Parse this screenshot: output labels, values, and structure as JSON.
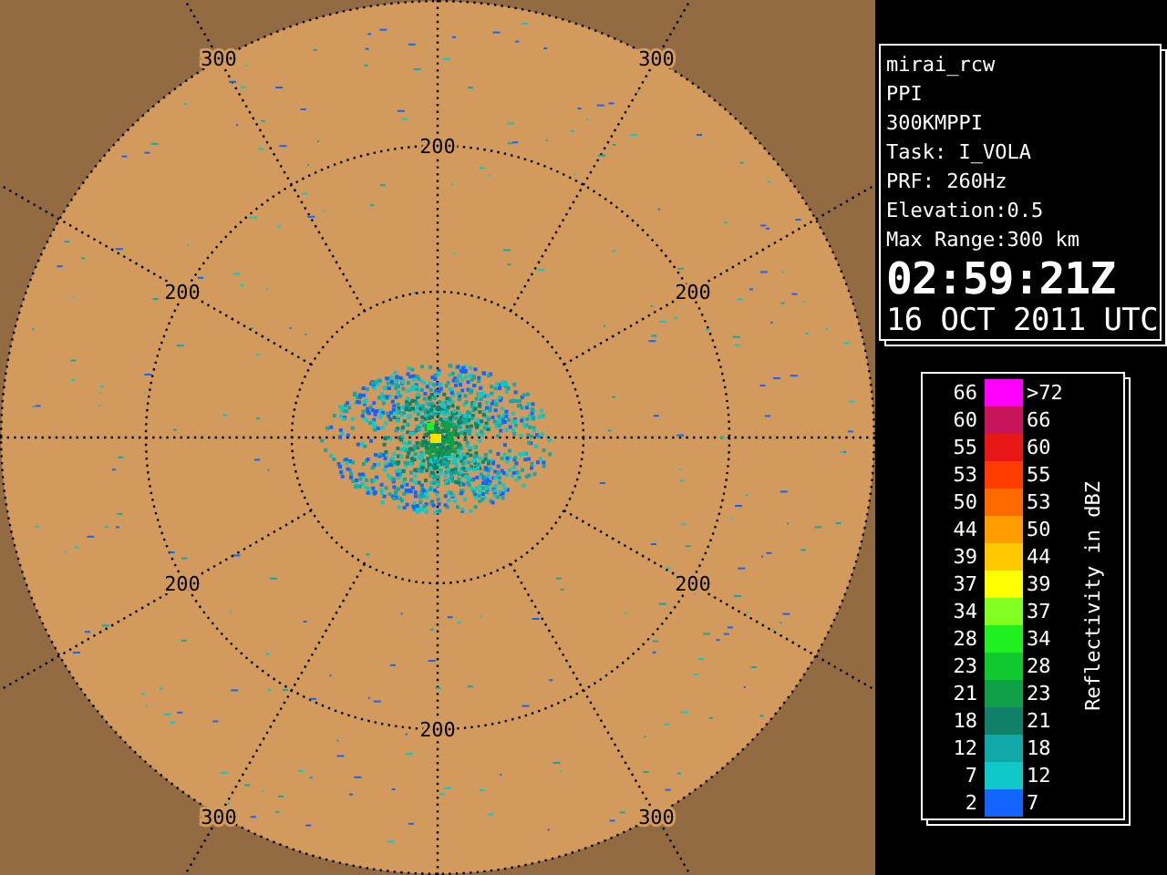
{
  "radar": {
    "range_labels": [
      "300",
      "300",
      "200",
      "200",
      "200",
      "200",
      "200",
      "200",
      "300",
      "300"
    ]
  },
  "info": {
    "lines": [
      "mirai_rcw",
      "PPI",
      "300KMPPI",
      "Task: I_VOLA",
      "PRF: 260Hz",
      "Elevation:0.5",
      "Max Range:300 km"
    ],
    "time": "02:59:21Z",
    "date": "16 OCT 2011 UTC"
  },
  "legend": {
    "title": "Reflectivity in dBZ",
    "rows": [
      {
        "low": "66",
        "high": ">72",
        "color": "#ff00ff"
      },
      {
        "low": "60",
        "high": "66",
        "color": "#c8145a"
      },
      {
        "low": "55",
        "high": "60",
        "color": "#e81818"
      },
      {
        "low": "53",
        "high": "55",
        "color": "#ff3c00"
      },
      {
        "low": "50",
        "high": "53",
        "color": "#ff6a00"
      },
      {
        "low": "44",
        "high": "50",
        "color": "#ff9c00"
      },
      {
        "low": "39",
        "high": "44",
        "color": "#ffc800"
      },
      {
        "low": "37",
        "high": "39",
        "color": "#ffff00"
      },
      {
        "low": "34",
        "high": "37",
        "color": "#80ff20"
      },
      {
        "low": "28",
        "high": "34",
        "color": "#20f020"
      },
      {
        "low": "23",
        "high": "28",
        "color": "#10c830"
      },
      {
        "low": "21",
        "high": "23",
        "color": "#10a048"
      },
      {
        "low": "18",
        "high": "21",
        "color": "#108068"
      },
      {
        "low": "12",
        "high": "18",
        "color": "#10a8a8"
      },
      {
        "low": "7",
        "high": "12",
        "color": "#10c8c8"
      },
      {
        "low": "2",
        "high": "7",
        "color": "#1464ff"
      }
    ]
  }
}
